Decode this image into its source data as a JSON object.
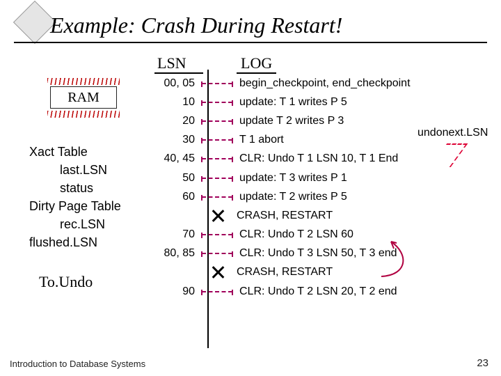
{
  "title": "Example: Crash During Restart!",
  "ram_label": "RAM",
  "left": {
    "xact": "Xact Table",
    "lastlsn": "last.LSN",
    "status": "status",
    "dpt": "Dirty Page Table",
    "reclsn": "rec.LSN",
    "flushed": "flushed.LSN"
  },
  "toundo": "To.Undo",
  "headers": {
    "lsn": "LSN",
    "log": "LOG"
  },
  "rows": [
    {
      "lsn": "00, 05",
      "log": "begin_checkpoint, end_checkpoint"
    },
    {
      "lsn": "10",
      "log": "update: T 1 writes P 5"
    },
    {
      "lsn": "20",
      "log": "update T 2 writes P 3"
    },
    {
      "lsn": "30",
      "log": "T 1 abort"
    },
    {
      "lsn": "40, 45",
      "log": "CLR: Undo T 1 LSN 10, T 1 End"
    },
    {
      "lsn": "50",
      "log": "update: T 3 writes P 1"
    },
    {
      "lsn": "60",
      "log": "update: T 2 writes P 5"
    },
    {
      "crash": true,
      "log": "CRASH, RESTART"
    },
    {
      "lsn": "70",
      "log": "CLR: Undo T 2 LSN 60"
    },
    {
      "lsn": "80, 85",
      "log": "CLR: Undo T 3 LSN 50, T 3 end"
    },
    {
      "crash": true,
      "log": "CRASH, RESTART"
    },
    {
      "lsn": "90",
      "log": "CLR: Undo T 2 LSN 20, T 2 end"
    }
  ],
  "undonext": "undonext.LSN",
  "footer": {
    "left": "Introduction to Database Systems",
    "page": "23"
  }
}
